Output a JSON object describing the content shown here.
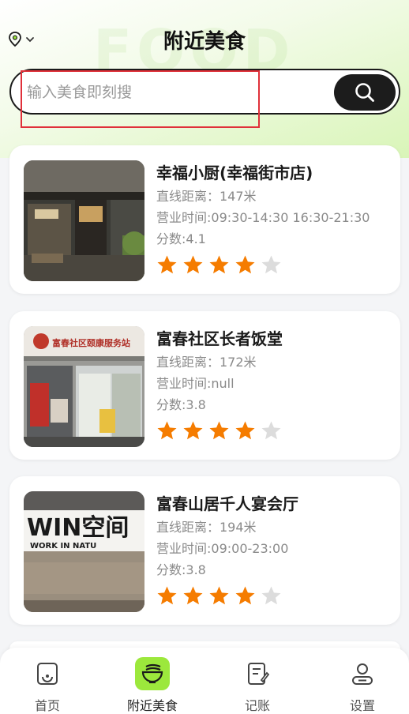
{
  "header": {
    "title": "附近美食",
    "watermark": "FOOD",
    "location_icon": "location-pin-icon",
    "dropdown_icon": "chevron-down-icon"
  },
  "search": {
    "placeholder": "输入美食即刻搜",
    "value": "",
    "button_icon": "search-icon"
  },
  "restaurants": [
    {
      "name": "幸福小厨(幸福街市店)",
      "distance": "直线距离：147米",
      "hours": "营业时间:09:30-14:30 16:30-21:30",
      "score": "分数:4.1",
      "rating": 4
    },
    {
      "name": "富春社区长者饭堂",
      "distance": "直线距离：172米",
      "hours": "营业时间:null",
      "score": "分数:3.8",
      "rating": 4,
      "photo_sign": "富春社区颐康服务站"
    },
    {
      "name": "富春山居千人宴会厅",
      "distance": "直线距离：194米",
      "hours": "营业时间:09:00-23:00",
      "score": "分数:3.8",
      "rating": 4,
      "photo_sign": "WIN空间",
      "photo_sign_sub": "WORK IN NATU"
    }
  ],
  "tabs": [
    {
      "label": "首页",
      "icon": "home-icon",
      "active": false
    },
    {
      "label": "附近美食",
      "icon": "noodle-bowl-icon",
      "active": true
    },
    {
      "label": "记账",
      "icon": "notebook-icon",
      "active": false
    },
    {
      "label": "设置",
      "icon": "user-settings-icon",
      "active": false
    }
  ],
  "colors": {
    "accent_green": "#9ce83c",
    "star_filled": "#f57c00",
    "star_empty": "#dcdcdc",
    "highlight_box": "#e0303a"
  }
}
